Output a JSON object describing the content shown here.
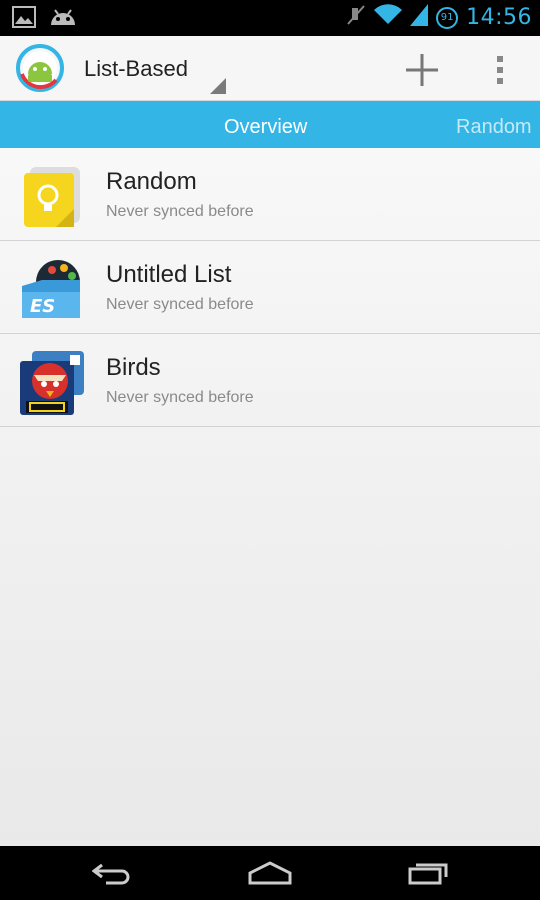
{
  "status_bar": {
    "time": "14:56",
    "battery_level": "91",
    "left_icons": [
      "image-notification-icon",
      "android-notification-icon"
    ],
    "right_icons": [
      "mute-icon",
      "wifi-icon",
      "signal-icon",
      "battery-icon"
    ],
    "accent_color": "#33b5e5"
  },
  "action_bar": {
    "app_icon": "android-sync-app-icon",
    "spinner_label": "List-Based",
    "add_icon": "add-icon",
    "overflow_icon": "overflow-menu-icon"
  },
  "tabs": {
    "active": "Overview",
    "next": "Random",
    "color": "#33b5e5"
  },
  "items": [
    {
      "title": "Random",
      "subtitle": "Never synced before",
      "icon": "keep-notes-icon"
    },
    {
      "title": "Untitled List",
      "subtitle": "Never synced before",
      "icon": "es-file-explorer-icon"
    },
    {
      "title": "Birds",
      "subtitle": "Never synced before",
      "icon": "angry-birds-star-wars-icon"
    }
  ],
  "nav_bar": {
    "back_icon": "back-icon",
    "home_icon": "home-icon",
    "recents_icon": "recent-apps-icon"
  }
}
